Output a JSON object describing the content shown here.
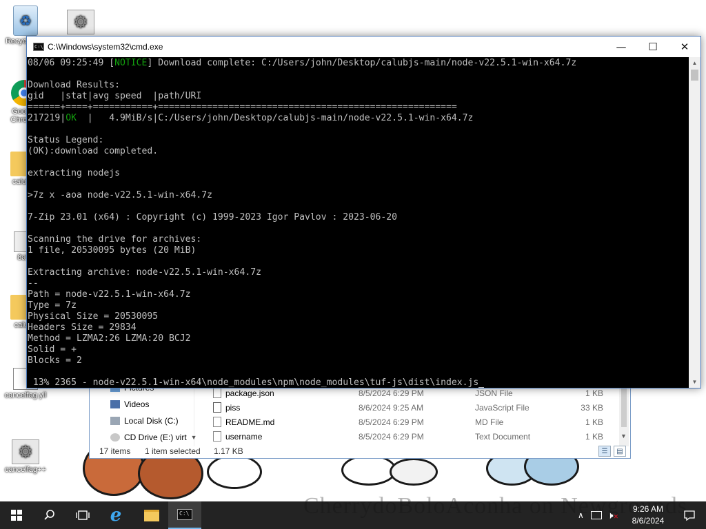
{
  "desktop": {
    "icons": [
      {
        "label": "Recycle Bin",
        "icon": "recycle-bin-icon"
      },
      {
        "label": "",
        "icon": "gear-icon"
      },
      {
        "label": "Google Chrome",
        "icon": "chrome-icon"
      },
      {
        "label": "calubjs",
        "icon": "folder-icon"
      },
      {
        "label": "8aY",
        "icon": "program-icon"
      },
      {
        "label": "calubj",
        "icon": "folder-icon"
      },
      {
        "label": "cancelfag.yil",
        "icon": "file-icon"
      },
      {
        "label": "cancelfag++",
        "icon": "gear-icon"
      }
    ],
    "watermark": "CherrydoBoloAconha on Newgrounds"
  },
  "cmd_window": {
    "title": "C:\\Windows\\system32\\cmd.exe",
    "buttons": {
      "minimize": "—",
      "maximize": "☐",
      "close": "✕"
    },
    "lines": [
      {
        "pre": "08/06 09:25:49 [",
        "hl": "NOTICE",
        "post": "] Download complete: C:/Users/john/Desktop/calubjs-main/node-v22.5.1-win-x64.7z"
      },
      {
        "pre": "",
        "hl": "",
        "post": ""
      },
      {
        "pre": "Download Results:",
        "hl": "",
        "post": ""
      },
      {
        "pre": "gid   |stat|avg speed  |path/URI",
        "hl": "",
        "post": ""
      },
      {
        "pre": "======+====+===========+=======================================================",
        "hl": "",
        "post": ""
      },
      {
        "pre": "217219|",
        "hl": "OK",
        "post": "  |   4.9MiB/s|C:/Users/john/Desktop/calubjs-main/node-v22.5.1-win-x64.7z"
      },
      {
        "pre": "",
        "hl": "",
        "post": ""
      },
      {
        "pre": "Status Legend:",
        "hl": "",
        "post": ""
      },
      {
        "pre": "(OK):download completed.",
        "hl": "",
        "post": ""
      },
      {
        "pre": "",
        "hl": "",
        "post": ""
      },
      {
        "pre": "extracting nodejs",
        "hl": "",
        "post": ""
      },
      {
        "pre": "",
        "hl": "",
        "post": ""
      },
      {
        "pre": ">7z x -aoa node-v22.5.1-win-x64.7z",
        "hl": "",
        "post": ""
      },
      {
        "pre": "",
        "hl": "",
        "post": ""
      },
      {
        "pre": "7-Zip 23.01 (x64) : Copyright (c) 1999-2023 Igor Pavlov : 2023-06-20",
        "hl": "",
        "post": ""
      },
      {
        "pre": "",
        "hl": "",
        "post": ""
      },
      {
        "pre": "Scanning the drive for archives:",
        "hl": "",
        "post": ""
      },
      {
        "pre": "1 file, 20530095 bytes (20 MiB)",
        "hl": "",
        "post": ""
      },
      {
        "pre": "",
        "hl": "",
        "post": ""
      },
      {
        "pre": "Extracting archive: node-v22.5.1-win-x64.7z",
        "hl": "",
        "post": ""
      },
      {
        "pre": "--",
        "hl": "",
        "post": ""
      },
      {
        "pre": "Path = node-v22.5.1-win-x64.7z",
        "hl": "",
        "post": ""
      },
      {
        "pre": "Type = 7z",
        "hl": "",
        "post": ""
      },
      {
        "pre": "Physical Size = 20530095",
        "hl": "",
        "post": ""
      },
      {
        "pre": "Headers Size = 29834",
        "hl": "",
        "post": ""
      },
      {
        "pre": "Method = LZMA2:26 LZMA:20 BCJ2",
        "hl": "",
        "post": ""
      },
      {
        "pre": "Solid = +",
        "hl": "",
        "post": ""
      },
      {
        "pre": "Blocks = 2",
        "hl": "",
        "post": ""
      },
      {
        "pre": "",
        "hl": "",
        "post": ""
      },
      {
        "pre": " 13% 2365 - node-v22.5.1-win-x64\\node_modules\\npm\\node_modules\\tuf-js\\dist\\index.js",
        "hl": "",
        "post": ""
      }
    ],
    "colors": {
      "background": "#000000",
      "text": "#c0c0c0",
      "highlight": "#13a10e"
    }
  },
  "explorer": {
    "nav": [
      {
        "label": "Pictures",
        "icon": "pictures-icon"
      },
      {
        "label": "Videos",
        "icon": "videos-icon"
      },
      {
        "label": "Local Disk (C:)",
        "icon": "drive-icon"
      },
      {
        "label": "CD Drive (E:) virt",
        "icon": "cd-drive-icon"
      }
    ],
    "files": [
      {
        "name": "package.json",
        "date": "8/5/2024 6:29 PM",
        "type": "JSON File",
        "size": "1 KB",
        "icon": "file-icon"
      },
      {
        "name": "piss",
        "date": "8/6/2024 9:25 AM",
        "type": "JavaScript File",
        "size": "33 KB",
        "icon": "script-icon"
      },
      {
        "name": "README.md",
        "date": "8/5/2024 6:29 PM",
        "type": "MD File",
        "size": "1 KB",
        "icon": "file-icon"
      },
      {
        "name": "username",
        "date": "8/5/2024 6:29 PM",
        "type": "Text Document",
        "size": "1 KB",
        "icon": "text-file-icon"
      }
    ],
    "status": {
      "count": "17 items",
      "selected": "1 item selected",
      "size": "1.17 KB"
    }
  },
  "taskbar": {
    "items": [
      "start",
      "search",
      "task-view",
      "internet-explorer",
      "file-explorer",
      "command-prompt"
    ],
    "clock": {
      "time": "9:26 AM",
      "date": "8/6/2024"
    }
  }
}
